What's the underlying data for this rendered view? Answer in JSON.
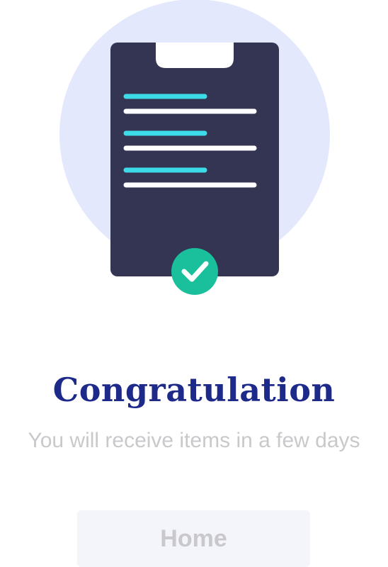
{
  "success": {
    "title": "Congratulation",
    "message": "You will receive items in a few days",
    "illustration_icon": "clipboard-icon",
    "status_icon": "check-circle-icon"
  },
  "actions": {
    "home_label": "Home"
  },
  "colors": {
    "circle_bg": "#e3e8fd",
    "clipboard": "#343552",
    "accent_line": "#3ddbea",
    "text_line": "#ffffff",
    "check_bg": "#1abf9b",
    "title": "#1e2a8a",
    "muted_text": "#c9c9cc",
    "button_bg": "#f4f5fb"
  }
}
